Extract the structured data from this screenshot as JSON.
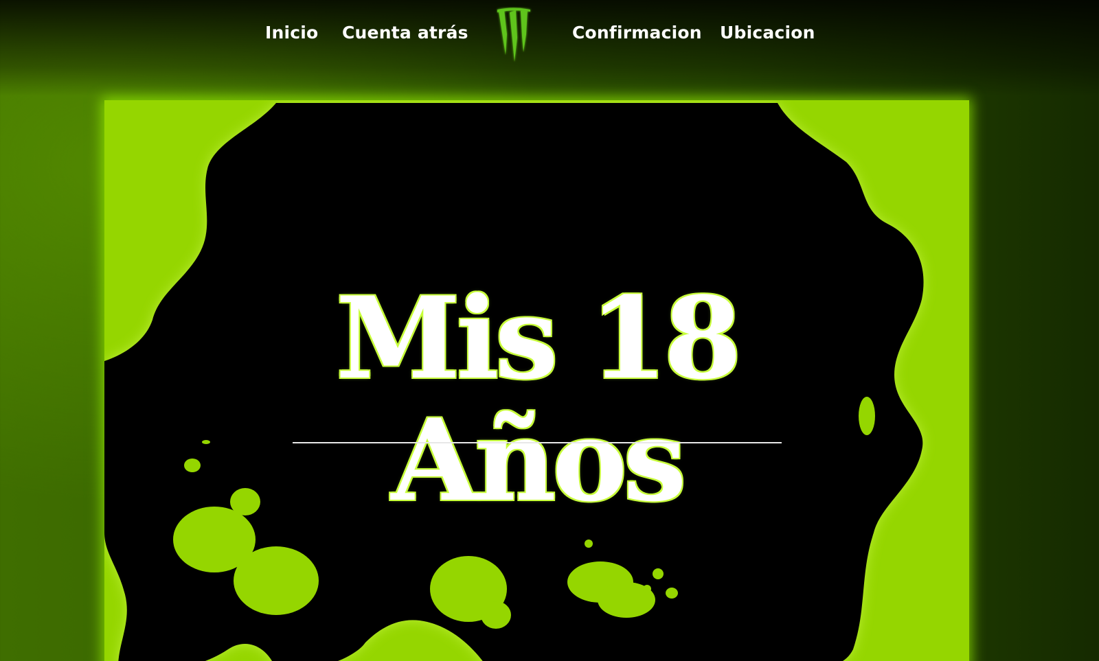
{
  "nav": {
    "items": [
      {
        "label": "Inicio"
      },
      {
        "label": "Cuenta atrás"
      },
      {
        "label": "Confirmacion"
      },
      {
        "label": "Ubicacion"
      }
    ],
    "logo_icon": "monster-claw-logo-icon"
  },
  "hero": {
    "title_line1": "Mis 18",
    "title_line2": "Años"
  },
  "colors": {
    "accent_green": "#95d600",
    "neon_glow": "#c8ff3a",
    "card_black": "#000000",
    "text_white": "#ffffff"
  }
}
